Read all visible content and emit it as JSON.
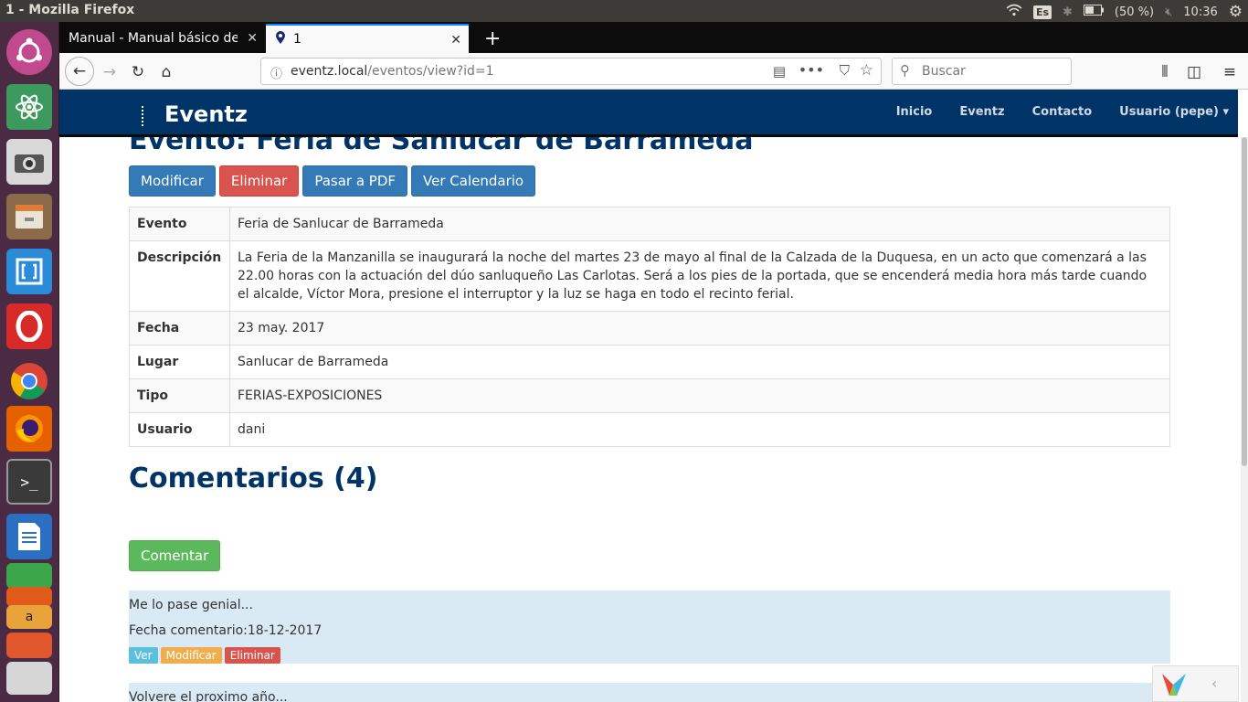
{
  "topbar": {
    "window_title": "1 - Mozilla Firefox",
    "keyboard_layout": "Es",
    "battery": "(50 %)",
    "time": "10:36"
  },
  "tabs": [
    {
      "label": "Manual - Manual básico de (",
      "active": false
    },
    {
      "label": "1",
      "active": true
    }
  ],
  "urlbar": {
    "host": "eventz.local",
    "path": "/eventos/view?id=1"
  },
  "search": {
    "placeholder": "Buscar"
  },
  "site": {
    "brand": "Eventz",
    "nav": [
      "Inicio",
      "Eventz",
      "Contacto",
      "Usuario (pepe) ▾"
    ]
  },
  "event": {
    "heading": "Evento: Feria de Sanlucar de Barrameda",
    "buttons": {
      "modify": "Modificar",
      "delete": "Eliminar",
      "pdf": "Pasar a PDF",
      "calendar": "Ver Calendario"
    },
    "rows": [
      {
        "label": "Evento",
        "value": "Feria de Sanlucar de Barrameda"
      },
      {
        "label": "Descripción",
        "value": "La Feria de la Manzanilla se inaugurará la noche del martes 23 de mayo al final de la Calzada de la Duquesa, en un acto que comenzará a las 22.00 horas con la actuación del dúo sanluqueño Las Carlotas. Será a los pies de la portada, que se encenderá media hora más tarde cuando el alcalde, Víctor Mora, presione el interruptor y la luz se haga en todo el recinto ferial."
      },
      {
        "label": "Fecha",
        "value": "23 may. 2017"
      },
      {
        "label": "Lugar",
        "value": "Sanlucar de Barrameda"
      },
      {
        "label": "Tipo",
        "value": "FERIAS-EXPOSICIONES"
      },
      {
        "label": "Usuario",
        "value": "dani"
      }
    ]
  },
  "comments": {
    "heading": "Comentarios (4)",
    "add_button": "Comentar",
    "items": [
      {
        "text": "Me lo pase genial...",
        "date": "Fecha comentario:18-12-2017",
        "view": "Ver",
        "modify": "Modificar",
        "delete": "Eliminar"
      },
      {
        "text": "Volvere el proximo año..."
      }
    ]
  },
  "colors": {
    "navbar": "#003366",
    "heading": "#003366",
    "comment_bg": "#d9eaf5"
  }
}
